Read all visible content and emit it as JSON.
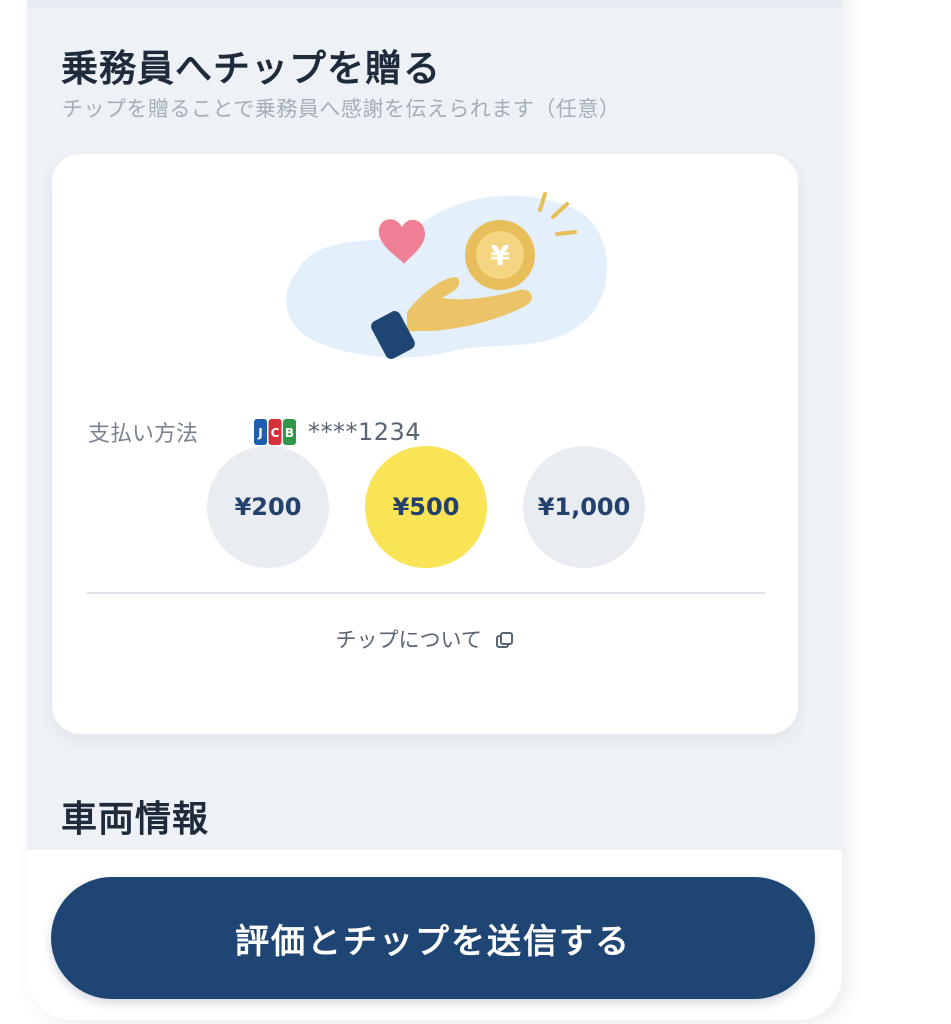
{
  "tip_section": {
    "title": "乗務員へチップを贈る",
    "subtitle": "チップを贈ることで乗務員へ感謝を伝えられます（任意）"
  },
  "payment": {
    "label": "支払い方法",
    "card_brand_icon": "jcb-card-icon",
    "card_number": "****1234"
  },
  "amounts": [
    {
      "label": "¥200",
      "selected": false
    },
    {
      "label": "¥500",
      "selected": true
    },
    {
      "label": "¥1,000",
      "selected": false
    }
  ],
  "about_link": {
    "label": "チップについて",
    "icon": "external-link-icon"
  },
  "vehicle_section": {
    "title": "車両情報"
  },
  "submit": {
    "label": "評価とチップを送信する"
  },
  "colors": {
    "primary": "#1f4575",
    "selected_amount": "#f8e455",
    "unselected_amount": "#e9ecf0",
    "page_bg": "#eef2f7"
  }
}
